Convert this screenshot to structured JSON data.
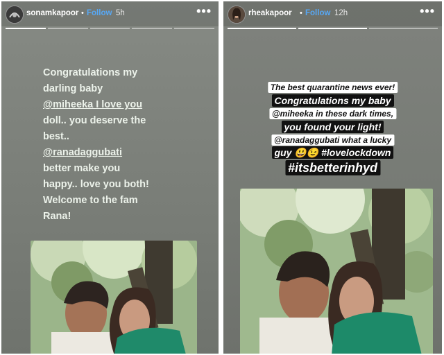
{
  "stories": [
    {
      "username": "sonamkapoor",
      "separator": "•",
      "follow_label": "Follow",
      "time": "5h",
      "more_label": "•••",
      "text_lines": [
        "Congratulations my",
        "darling baby",
        "@miheeka I love you",
        "doll.. you deserve the",
        "best..",
        "@ranadaggubati",
        "better make you",
        "happy.. love you both!",
        "Welcome to the fam",
        "Rana!"
      ]
    },
    {
      "username": "rheakapoor",
      "separator": "•",
      "follow_label": "Follow",
      "time": "12h",
      "more_label": "•••",
      "text_lines": [
        "The best quarantine news ever!",
        "Congratulations my baby",
        "@miheeka in these dark times,",
        "you found your light!",
        "@ranadaggubati what a lucky",
        "guy 😃😉 #lovelockdown",
        "#itsbetterinhyd"
      ]
    }
  ]
}
